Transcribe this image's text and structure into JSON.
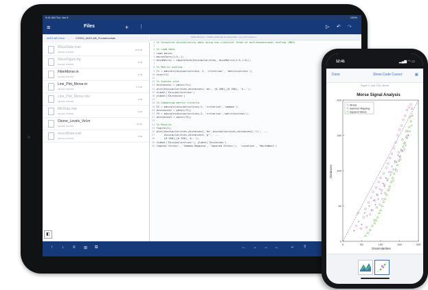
{
  "ipad": {
    "status_time": "9:41 AM  Tue Jan 9",
    "status_battery": "100%",
    "panel_title": "Files",
    "add_icon": "plus-icon",
    "tabs": [
      "MATLAB Drive",
      "CSS52_MATLAB_Fundamentals"
    ],
    "files": [
      {
        "name": "WaveData.mat",
        "date": "12/1/19, 5:03 PM",
        "size": "16.8 KB",
        "dim": true
      },
      {
        "name": "WaveFigure.fig",
        "date": "12/1/19, 4:58 PM",
        "size": "3 KB",
        "dim": true
      },
      {
        "name": "FilterMorse.m",
        "date": "12/1/19, 5:01 PM",
        "size": "3 KB",
        "dim": false
      },
      {
        "name": "Line_Plot_Morse.m",
        "date": "12/1/19, 5:02 PM",
        "size": "1.5 KB",
        "dim": false
      },
      {
        "name": "Line_Plot_Morse.mlx",
        "date": "12/1/19, 5:04 PM",
        "size": "3 KB",
        "dim": true
      },
      {
        "name": "MEData.mat",
        "date": "12/1/19, 5:05 PM",
        "size": "2 KB",
        "dim": true
      },
      {
        "name": "Ozone_Levels_Vol.m",
        "date": "12/1/19, 5:07 PM",
        "size": "16 KB",
        "dim": false
      },
      {
        "name": "soundData.mat",
        "date": "12/1/19, 5:09 PM",
        "size": "4 KB",
        "dim": true
      }
    ],
    "path": "MATLAB Drive > CSS52_MATLAB_Fundamentals > Line_Plot_Morse.m",
    "code_lines": [
      {
        "n": "1",
        "t": "%% Visualize dissimilarity data using two classical forms of multidimensional scaling (MDS)",
        "k": "cm"
      },
      {
        "n": "2",
        "t": "",
        "k": ""
      },
      {
        "n": "3",
        "t": "%% Load data",
        "k": "cm"
      },
      {
        "n": "4",
        "t": "load morse;",
        "k": ""
      },
      {
        "n": "5",
        "t": "morseChars(1:5,:);",
        "k": ""
      },
      {
        "n": "6",
        "t": "dissMatrix = squareform(dissimilarities, dissMatrix(1:5,1:5));",
        "k": ""
      },
      {
        "n": "7",
        "t": "",
        "k": ""
      },
      {
        "n": "8",
        "t": "%% Metric scaling",
        "k": "cm"
      },
      {
        "n": "9",
        "t": "Y1 = mdscale(dissimilarities, 2, 'criterion', 'metricsstress');",
        "k": ""
      },
      {
        "n": "10",
        "t": "size(Y1)",
        "k": ""
      },
      {
        "n": "11",
        "t": "",
        "k": ""
      },
      {
        "n": "12",
        "t": "%% Scatter plot",
        "k": "cm"
      },
      {
        "n": "13",
        "t": "distances1 = pdist(Y1);",
        "k": ""
      },
      {
        "n": "14",
        "t": "plot(dissimilarities,distances1,'bo', [0 200],[0 200], 'k--');",
        "k": ""
      },
      {
        "n": "15",
        "t": "xlabel('Dissimilarities')",
        "k": ""
      },
      {
        "n": "16",
        "t": "ylabel('Distances')",
        "k": ""
      },
      {
        "n": "17",
        "t": "",
        "k": ""
      },
      {
        "n": "18",
        "t": "%% Comparing metric criteria",
        "k": "cm"
      },
      {
        "n": "19",
        "t": "Y2 = mdscale(dissimilarities,2, 'criterion','sammon');",
        "k": ""
      },
      {
        "n": "20",
        "t": "distances2 = pdist(Y2);",
        "k": ""
      },
      {
        "n": "21",
        "t": "Y3 = mdscale(dissimilarities,2, 'criterion','metricsstress');",
        "k": ""
      },
      {
        "n": "22",
        "t": "distances3 = pdist(Y3);",
        "k": ""
      },
      {
        "n": "23",
        "t": "",
        "k": ""
      },
      {
        "n": "24",
        "t": "%% Results",
        "k": "cm"
      },
      {
        "n": "25",
        "t": "figure(1);",
        "k": ""
      },
      {
        "n": "26",
        "t": "plot(dissimilarities,distances1,'bo',dissimilarities,distances2,'r+', ...",
        "k": ""
      },
      {
        "n": "27",
        "t": "     dissimilarities,distances3,'g^', ...",
        "k": ""
      },
      {
        "n": "28",
        "t": "     [0 200],[0 200],'k--');",
        "k": ""
      },
      {
        "n": "29",
        "t": "xlabel('Dissimilarities'); ylabel('Distances')",
        "k": ""
      },
      {
        "n": "30",
        "t": "legend('Stress', 'Sammon Mapping', 'Squared Stress');  'Location', 'NorthWest')",
        "k": ""
      }
    ],
    "toolbar_tools": [
      "↑",
      "↓",
      "≡",
      "⊞",
      "⧉",
      "←",
      "→",
      "→",
      "←",
      "⌐",
      "?"
    ]
  },
  "iphone": {
    "time": "12:41",
    "signal": "▂▄▆ ◠ ▭",
    "done_label": "Done",
    "show_code_label": "Show Code Cursor",
    "subtitle": "Figure 1: Line_Plot_Morse",
    "chart_data": {
      "type": "scatter",
      "title": "Morse Signal Analysis",
      "xlabel": "Dissimilarities",
      "ylabel": "Distances",
      "xlim": [
        0,
        200
      ],
      "ylim": [
        0,
        200
      ],
      "xticks": [
        0,
        50,
        100,
        150,
        200
      ],
      "yticks": [
        0,
        50,
        100,
        150,
        200
      ],
      "legend": [
        "Stress",
        "Sammon Mapping",
        "Squared Stress"
      ],
      "series": [
        {
          "name": "Stress",
          "color": "#c27bc4",
          "x": [
            35,
            40,
            48,
            55,
            60,
            63,
            68,
            72,
            75,
            78,
            80,
            83,
            85,
            88,
            90,
            92,
            95,
            98,
            100,
            103,
            105,
            108,
            110,
            112,
            115,
            118,
            120,
            122,
            125,
            128,
            130,
            133,
            135,
            138,
            140,
            142,
            145,
            148,
            150,
            152,
            155,
            158,
            160,
            162,
            165,
            168,
            170,
            172,
            175,
            178,
            180,
            183
          ],
          "y": [
            22,
            40,
            18,
            34,
            46,
            20,
            55,
            38,
            62,
            44,
            70,
            30,
            58,
            76,
            48,
            66,
            84,
            52,
            90,
            72,
            60,
            96,
            80,
            68,
            104,
            88,
            110,
            74,
            118,
            98,
            124,
            86,
            132,
            112,
            140,
            100,
            150,
            126,
            158,
            116,
            164,
            144,
            172,
            130,
            178,
            156,
            186,
            150,
            190,
            176,
            194,
            188
          ]
        },
        {
          "name": "Sammon Mapping",
          "color": "#8a8f9a",
          "x": [
            30,
            42,
            50,
            58,
            64,
            70,
            76,
            82,
            86,
            90,
            94,
            98,
            102,
            106,
            110,
            114,
            118,
            122,
            126,
            130,
            134,
            138,
            142,
            146,
            150,
            154,
            158,
            162,
            166,
            170,
            174,
            178,
            182
          ],
          "y": [
            15,
            28,
            24,
            40,
            36,
            50,
            44,
            58,
            52,
            66,
            60,
            74,
            68,
            82,
            78,
            90,
            86,
            98,
            94,
            106,
            102,
            114,
            112,
            122,
            120,
            130,
            128,
            138,
            136,
            146,
            150,
            156,
            164
          ]
        },
        {
          "name": "Squared Stress",
          "color": "#5dcc3c",
          "x": [
            60,
            66,
            72,
            78,
            84,
            88,
            92,
            96,
            100,
            104,
            108,
            112,
            116,
            120,
            124,
            128,
            132,
            136,
            140,
            144,
            148,
            152,
            156,
            160,
            164,
            168,
            172,
            176,
            180,
            184
          ],
          "y": [
            8,
            12,
            16,
            22,
            26,
            30,
            34,
            40,
            44,
            50,
            56,
            60,
            66,
            72,
            78,
            84,
            90,
            96,
            102,
            108,
            114,
            120,
            128,
            134,
            140,
            148,
            156,
            162,
            170,
            178
          ]
        }
      ]
    }
  }
}
